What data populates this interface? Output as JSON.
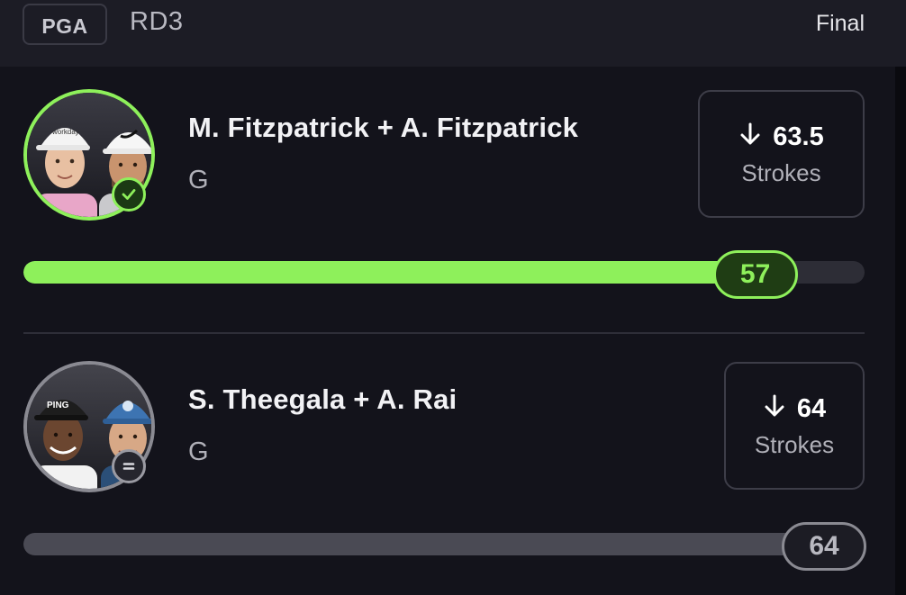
{
  "header": {
    "league": "PGA",
    "round": "RD3",
    "status": "Final"
  },
  "colors": {
    "win_accent": "#8ef05b",
    "push_accent": "#8a8a92",
    "background": "#13131b"
  },
  "entries": [
    {
      "players": "M. Fitzpatrick + A. Fitzpatrick",
      "position": "G",
      "projection_value": "63.5",
      "projection_direction_icon": "arrow-down-icon",
      "projection_unit": "Strokes",
      "result_value": "57",
      "result_status": "win",
      "status_icon": "check-icon",
      "progress_fraction": 0.87
    },
    {
      "players": "S. Theegala + A. Rai",
      "position": "G",
      "projection_value": "64",
      "projection_direction_icon": "arrow-down-icon",
      "projection_unit": "Strokes",
      "result_value": "64",
      "result_status": "push",
      "status_icon": "equals-icon",
      "progress_fraction": 0.97
    }
  ]
}
